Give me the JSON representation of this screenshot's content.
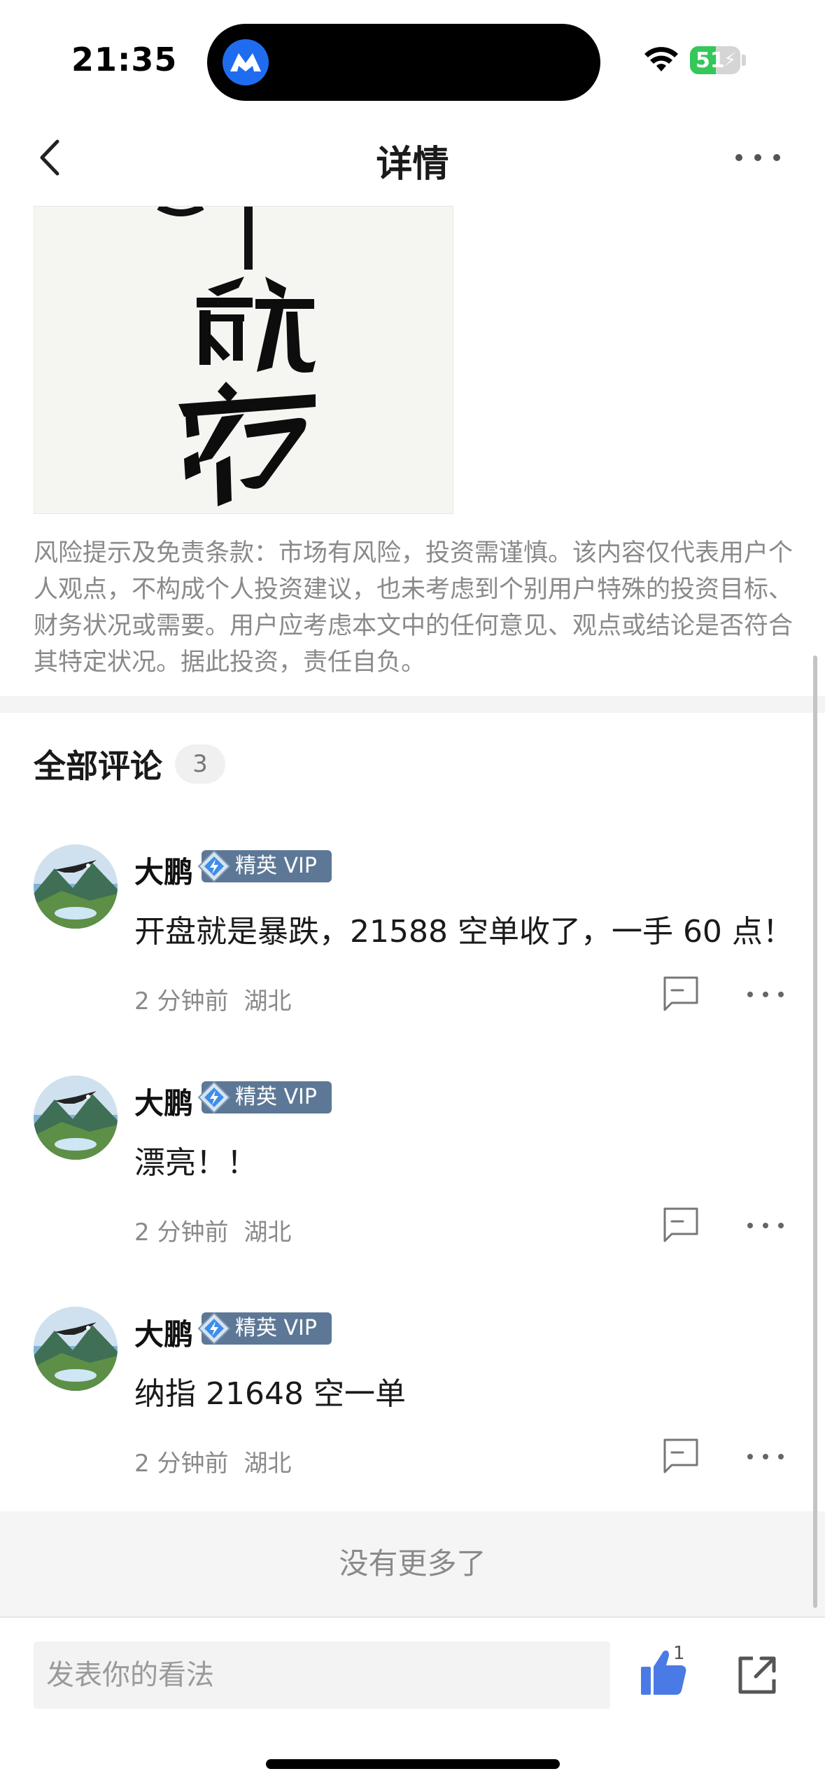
{
  "status_bar": {
    "time": "21:35",
    "battery": "51",
    "battery_level": 0.51,
    "app_icon": "feather-app-icon",
    "wifi_icon": "wifi-icon",
    "battery_color": "#34c759"
  },
  "nav": {
    "title": "详情",
    "back_icon": "chevron-left-icon",
    "more_icon": "ellipsis-icon"
  },
  "post": {
    "image_alt": "calligraphy-image",
    "disclaimer": "风险提示及免责条款：市场有风险，投资需谨慎。该内容仅代表用户个人观点，不构成个人投资建议，也未考虑到个别用户特殊的投资目标、财务状况或需要。用户应考虑本文中的任何意见、观点或结论是否符合其特定状况。据此投资，责任自负。"
  },
  "comments": {
    "title": "全部评论",
    "count": "3",
    "items": [
      {
        "user": "大鹏",
        "badge": "精英 VIP",
        "text": "开盘就是暴跌，21588 空单收了，一手 60 点！",
        "time": "2 分钟前",
        "location": "湖北"
      },
      {
        "user": "大鹏",
        "badge": "精英 VIP",
        "text": "漂亮！！",
        "time": "2 分钟前",
        "location": "湖北"
      },
      {
        "user": "大鹏",
        "badge": "精英 VIP",
        "text": "纳指 21648 空一单",
        "time": "2 分钟前",
        "location": "湖北"
      }
    ],
    "no_more": "没有更多了"
  },
  "bottom_bar": {
    "placeholder": "发表你的看法",
    "like_count": "1",
    "like_icon": "thumbs-up-icon",
    "share_icon": "share-icon",
    "accent_color": "#4a7ae6"
  }
}
